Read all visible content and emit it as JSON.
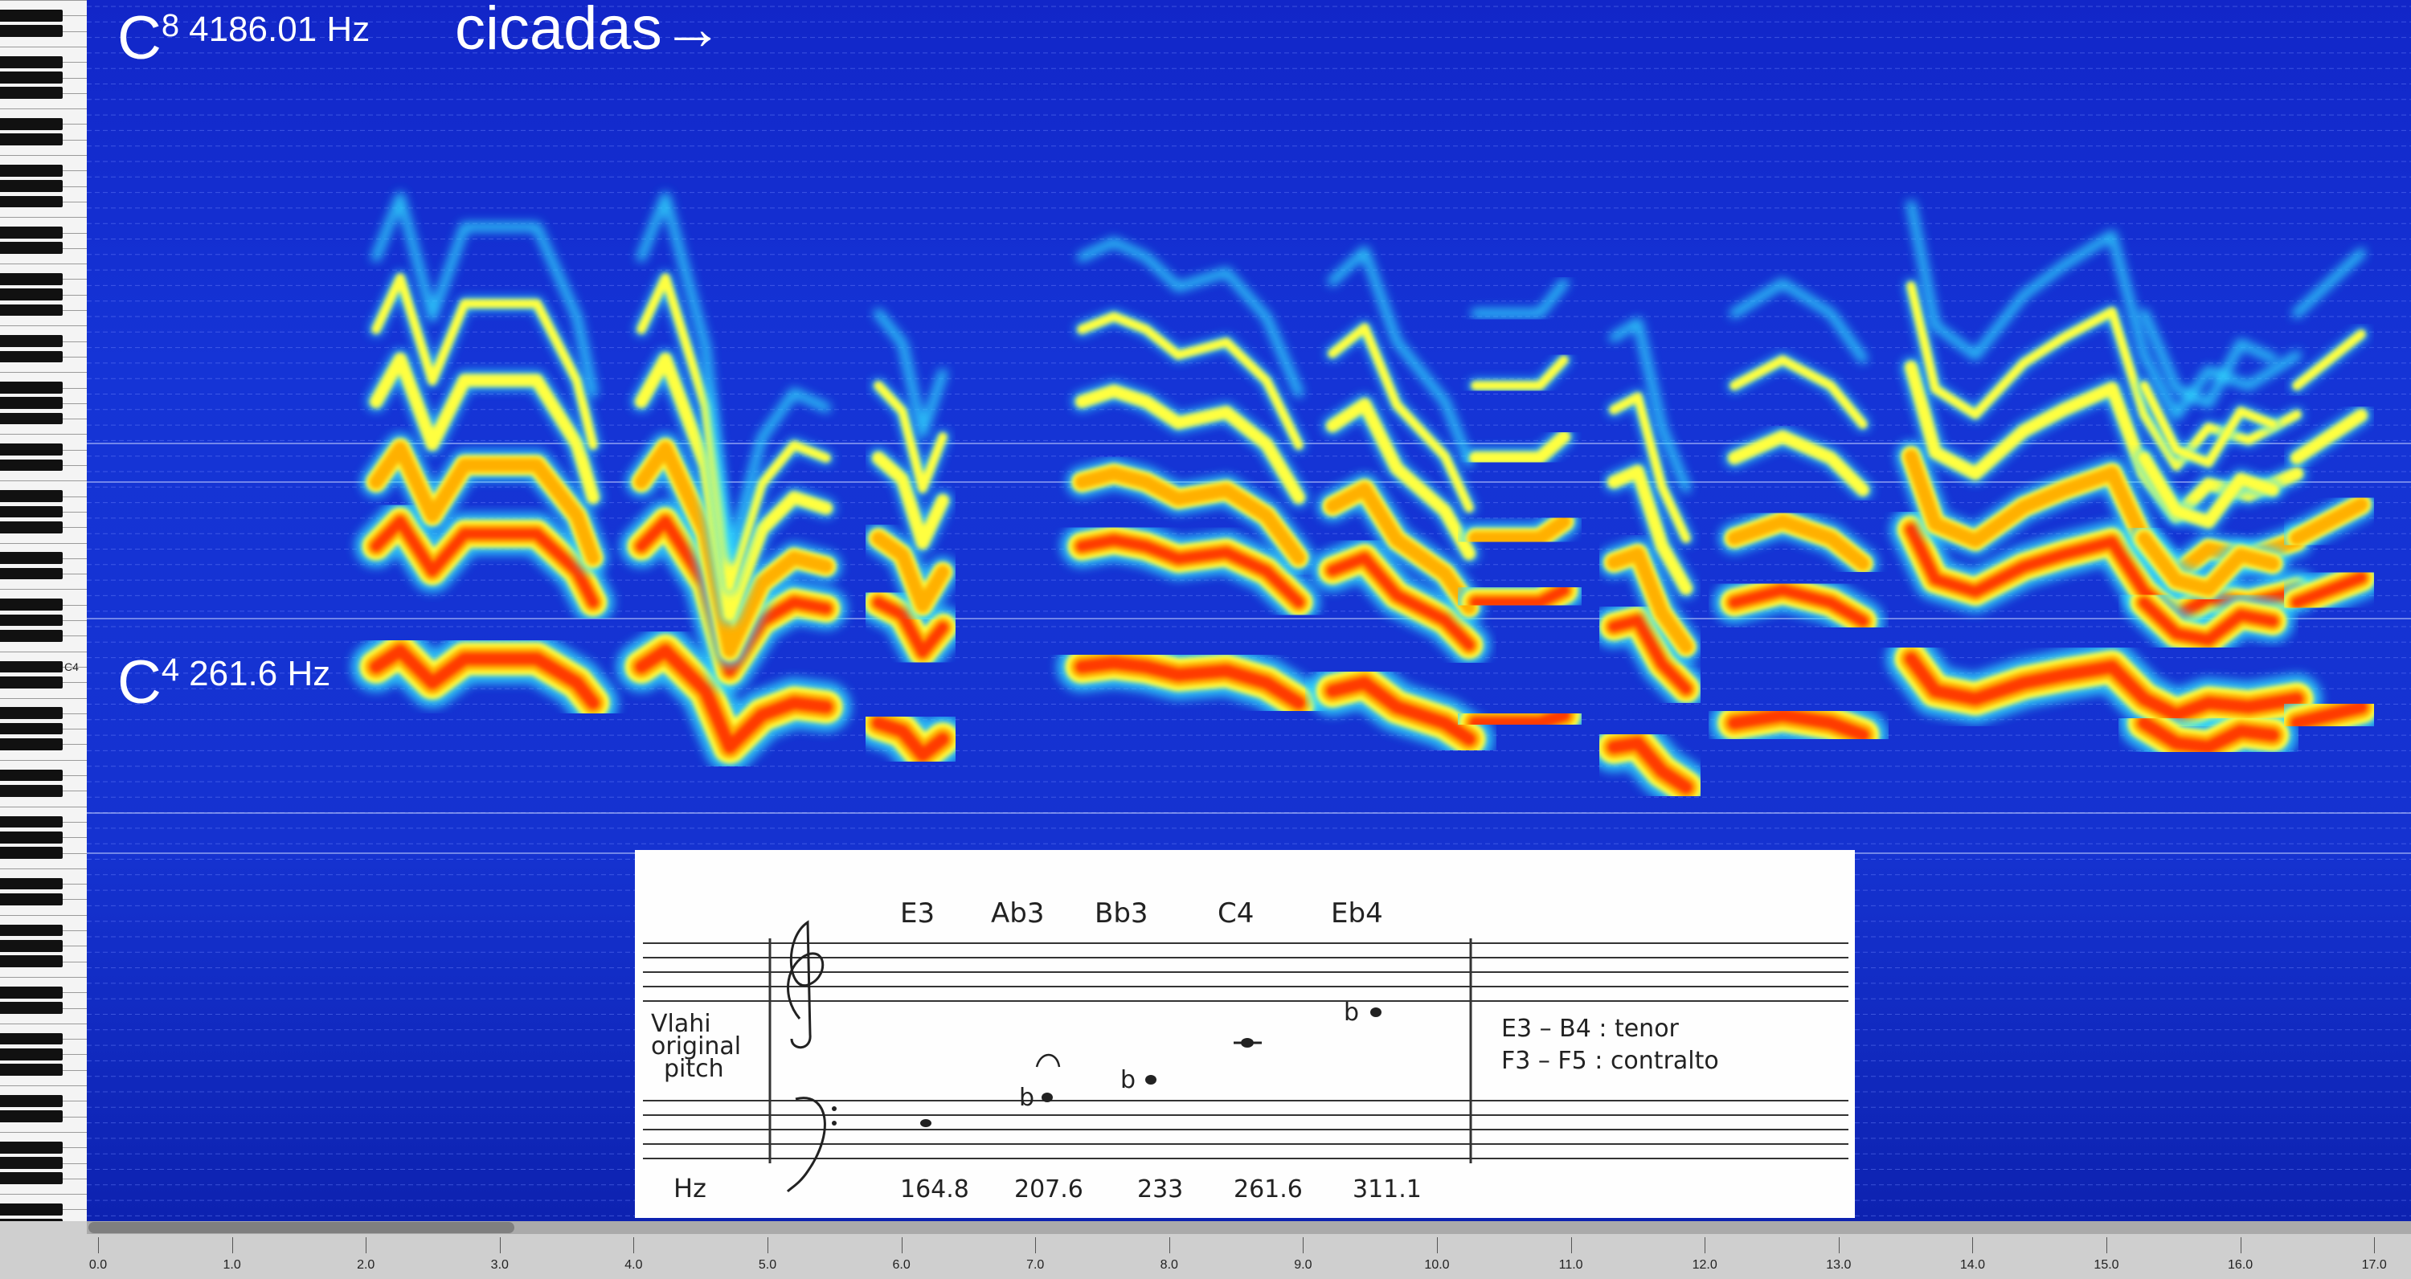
{
  "overlay": {
    "c8_letter": "C",
    "c8_octave": "8",
    "c8_hz": "4186.01 Hz",
    "cicadas": "cicadas→",
    "c4_letter": "C",
    "c4_octave": "4",
    "c4_hz": "261.6 Hz"
  },
  "piano": {
    "c4_label": "C4"
  },
  "sheet": {
    "notes": [
      "E3",
      "Ab3",
      "Bb3",
      "C4",
      "Eb4"
    ],
    "left_label_lines": [
      "Vlahi",
      "original",
      "pitch"
    ],
    "hz_label": "Hz",
    "freqs": [
      "164.8",
      "207.6",
      "233",
      "261.6",
      "311.1"
    ],
    "range_line1": "E3 – B4 : tenor",
    "range_line2": "F3 – F5 : contralto"
  },
  "timeline": {
    "ticks": [
      "0.0",
      "1.0",
      "2.0",
      "3.0",
      "4.0",
      "5.0",
      "6.0",
      "7.0",
      "8.0",
      "9.0",
      "10.0",
      "11.0",
      "12.0",
      "13.0",
      "14.0",
      "15.0",
      "16.0",
      "17.0"
    ]
  },
  "colors": {
    "background": "#1532d0",
    "hot": "#ff3a00",
    "warm": "#ffb000",
    "mid": "#ffff40",
    "cool": "#30e0ff"
  }
}
